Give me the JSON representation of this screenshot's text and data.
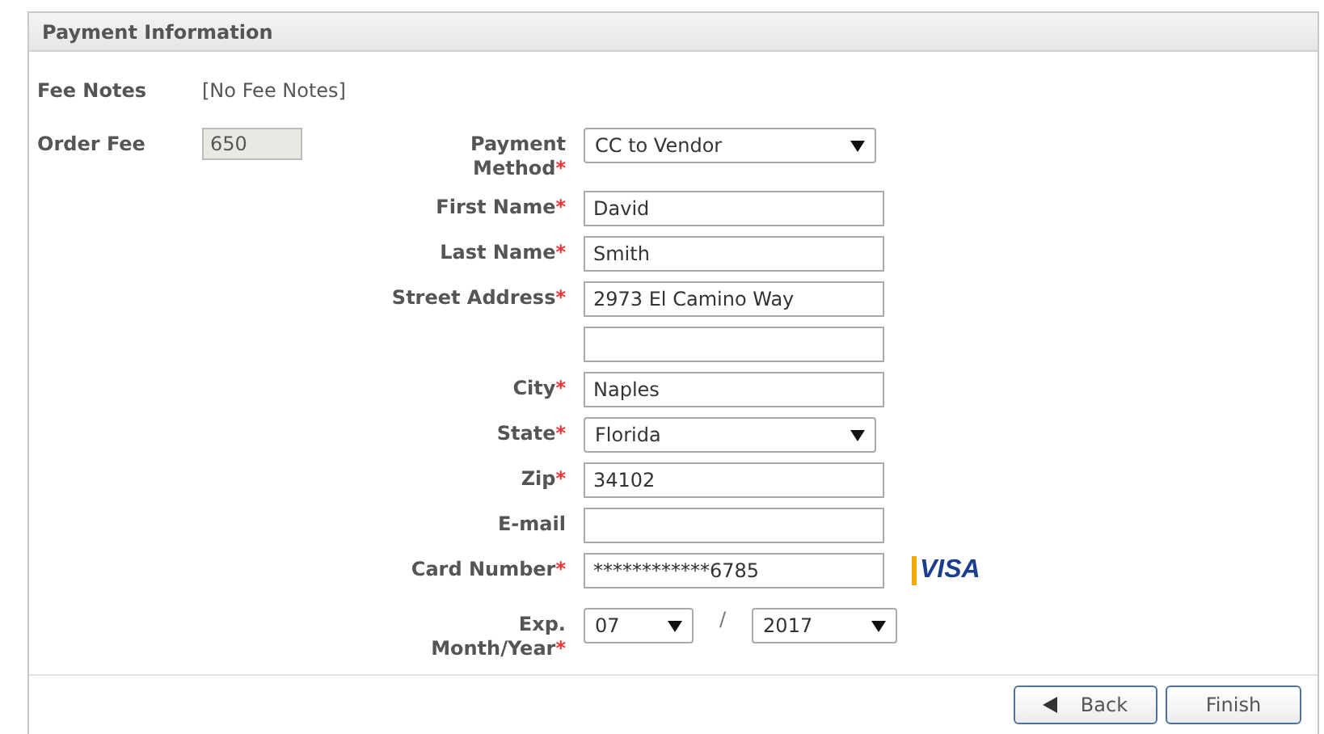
{
  "panel": {
    "title": "Payment Information"
  },
  "fee_notes": {
    "label": "Fee Notes",
    "value": "[No Fee Notes]"
  },
  "order_fee": {
    "label": "Order Fee",
    "value": "650",
    "disabled": true
  },
  "fields": [
    {
      "kind": "select",
      "label": "Payment\nMethod",
      "required_mark": "*",
      "value": "CC to Vendor"
    },
    {
      "kind": "text",
      "label": "First Name",
      "required_mark": "*",
      "value": "David"
    },
    {
      "kind": "text",
      "label": "Last Name",
      "required_mark": "*",
      "value": "Smith"
    },
    {
      "kind": "text",
      "label": "Street Address",
      "required_mark": "*",
      "value": "2973 El Camino Way"
    },
    {
      "kind": "text"
    },
    {
      "kind": "text",
      "label": "City",
      "required_mark": "*",
      "value": "Naples"
    },
    {
      "kind": "select",
      "label": "State",
      "required_mark": "*",
      "value": "Florida"
    },
    {
      "kind": "text",
      "label": "Zip",
      "required_mark": "*",
      "value": "34102"
    },
    {
      "kind": "text",
      "label": "E-mail"
    },
    {
      "kind": "card",
      "label": "Card Number",
      "required_mark": "*",
      "value": "************6785",
      "brand": "VISA"
    },
    {
      "kind": "date",
      "label": "Exp.\nMonth/Year",
      "required_mark": "*",
      "month": "07",
      "separator": "/",
      "year": "2017"
    }
  ],
  "buttons": [
    {
      "kind": "back",
      "label": "Back"
    },
    {
      "kind": "plain",
      "label": "Finish"
    }
  ]
}
